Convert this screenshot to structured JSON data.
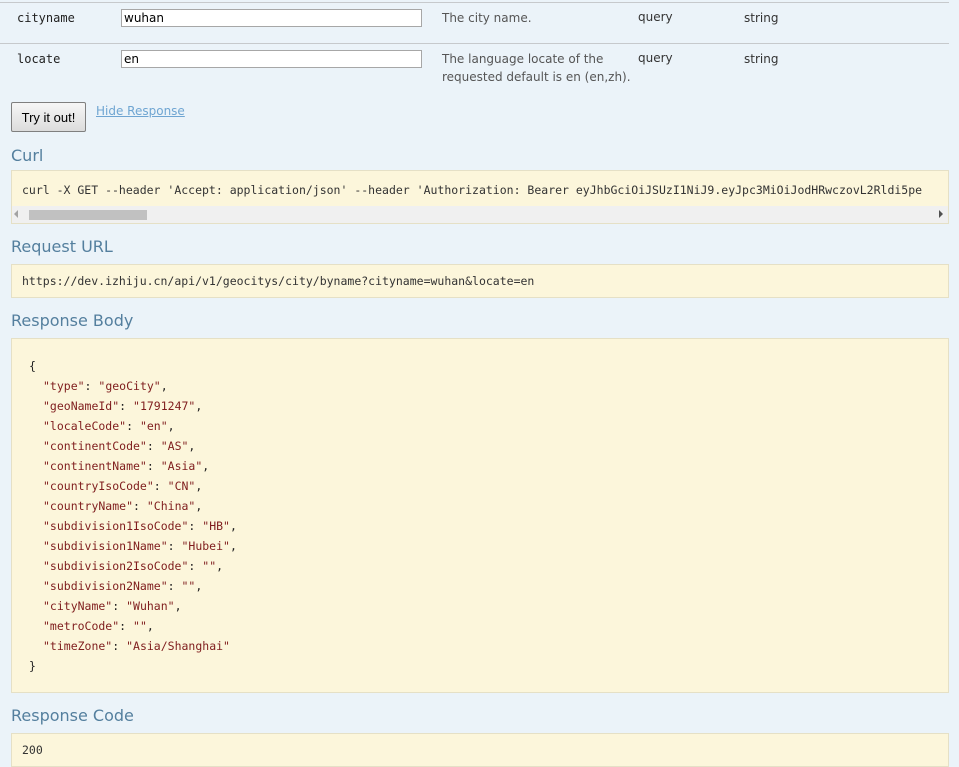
{
  "params": [
    {
      "name": "cityname",
      "value": "wuhan",
      "description": "The city name.",
      "param_type": "query",
      "data_type": "string"
    },
    {
      "name": "locate",
      "value": "en",
      "description": "The language locate of the requested default is en (en,zh).",
      "param_type": "query",
      "data_type": "string"
    }
  ],
  "actions": {
    "try_label": "Try it out!",
    "hide_label": "Hide Response"
  },
  "sections": {
    "curl": "Curl",
    "request_url": "Request URL",
    "response_body": "Response Body",
    "response_code": "Response Code"
  },
  "curl_command": "curl -X GET --header 'Accept: application/json' --header 'Authorization: Bearer eyJhbGciOiJSUzI1NiJ9.eyJpc3MiOiJodHRwczovL2Rldi5pe",
  "request_url": "https://dev.izhiju.cn/api/v1/geocitys/city/byname?cityname=wuhan&locate=en",
  "response_body": {
    "open": "{",
    "close": "}",
    "fields": [
      {
        "key": "\"type\"",
        "value": "\"geoCity\"",
        "sep": ","
      },
      {
        "key": "\"geoNameId\"",
        "value": "\"1791247\"",
        "sep": ","
      },
      {
        "key": "\"localeCode\"",
        "value": "\"en\"",
        "sep": ","
      },
      {
        "key": "\"continentCode\"",
        "value": "\"AS\"",
        "sep": ","
      },
      {
        "key": "\"continentName\"",
        "value": "\"Asia\"",
        "sep": ","
      },
      {
        "key": "\"countryIsoCode\"",
        "value": "\"CN\"",
        "sep": ","
      },
      {
        "key": "\"countryName\"",
        "value": "\"China\"",
        "sep": ","
      },
      {
        "key": "\"subdivision1IsoCode\"",
        "value": "\"HB\"",
        "sep": ","
      },
      {
        "key": "\"subdivision1Name\"",
        "value": "\"Hubei\"",
        "sep": ","
      },
      {
        "key": "\"subdivision2IsoCode\"",
        "value": "\"\"",
        "sep": ","
      },
      {
        "key": "\"subdivision2Name\"",
        "value": "\"\"",
        "sep": ","
      },
      {
        "key": "\"cityName\"",
        "value": "\"Wuhan\"",
        "sep": ","
      },
      {
        "key": "\"metroCode\"",
        "value": "\"\"",
        "sep": ","
      },
      {
        "key": "\"timeZone\"",
        "value": "\"Asia/Shanghai\"",
        "sep": ""
      }
    ]
  },
  "response_code": "200",
  "colors": {
    "background": "#ebf3f9",
    "heading": "#547f9e",
    "code_bg": "#fcf6db",
    "link": "#6fa5d2"
  },
  "icons": {
    "scroll_left": "scroll-left-arrow-icon",
    "scroll_right": "scroll-right-arrow-icon"
  }
}
